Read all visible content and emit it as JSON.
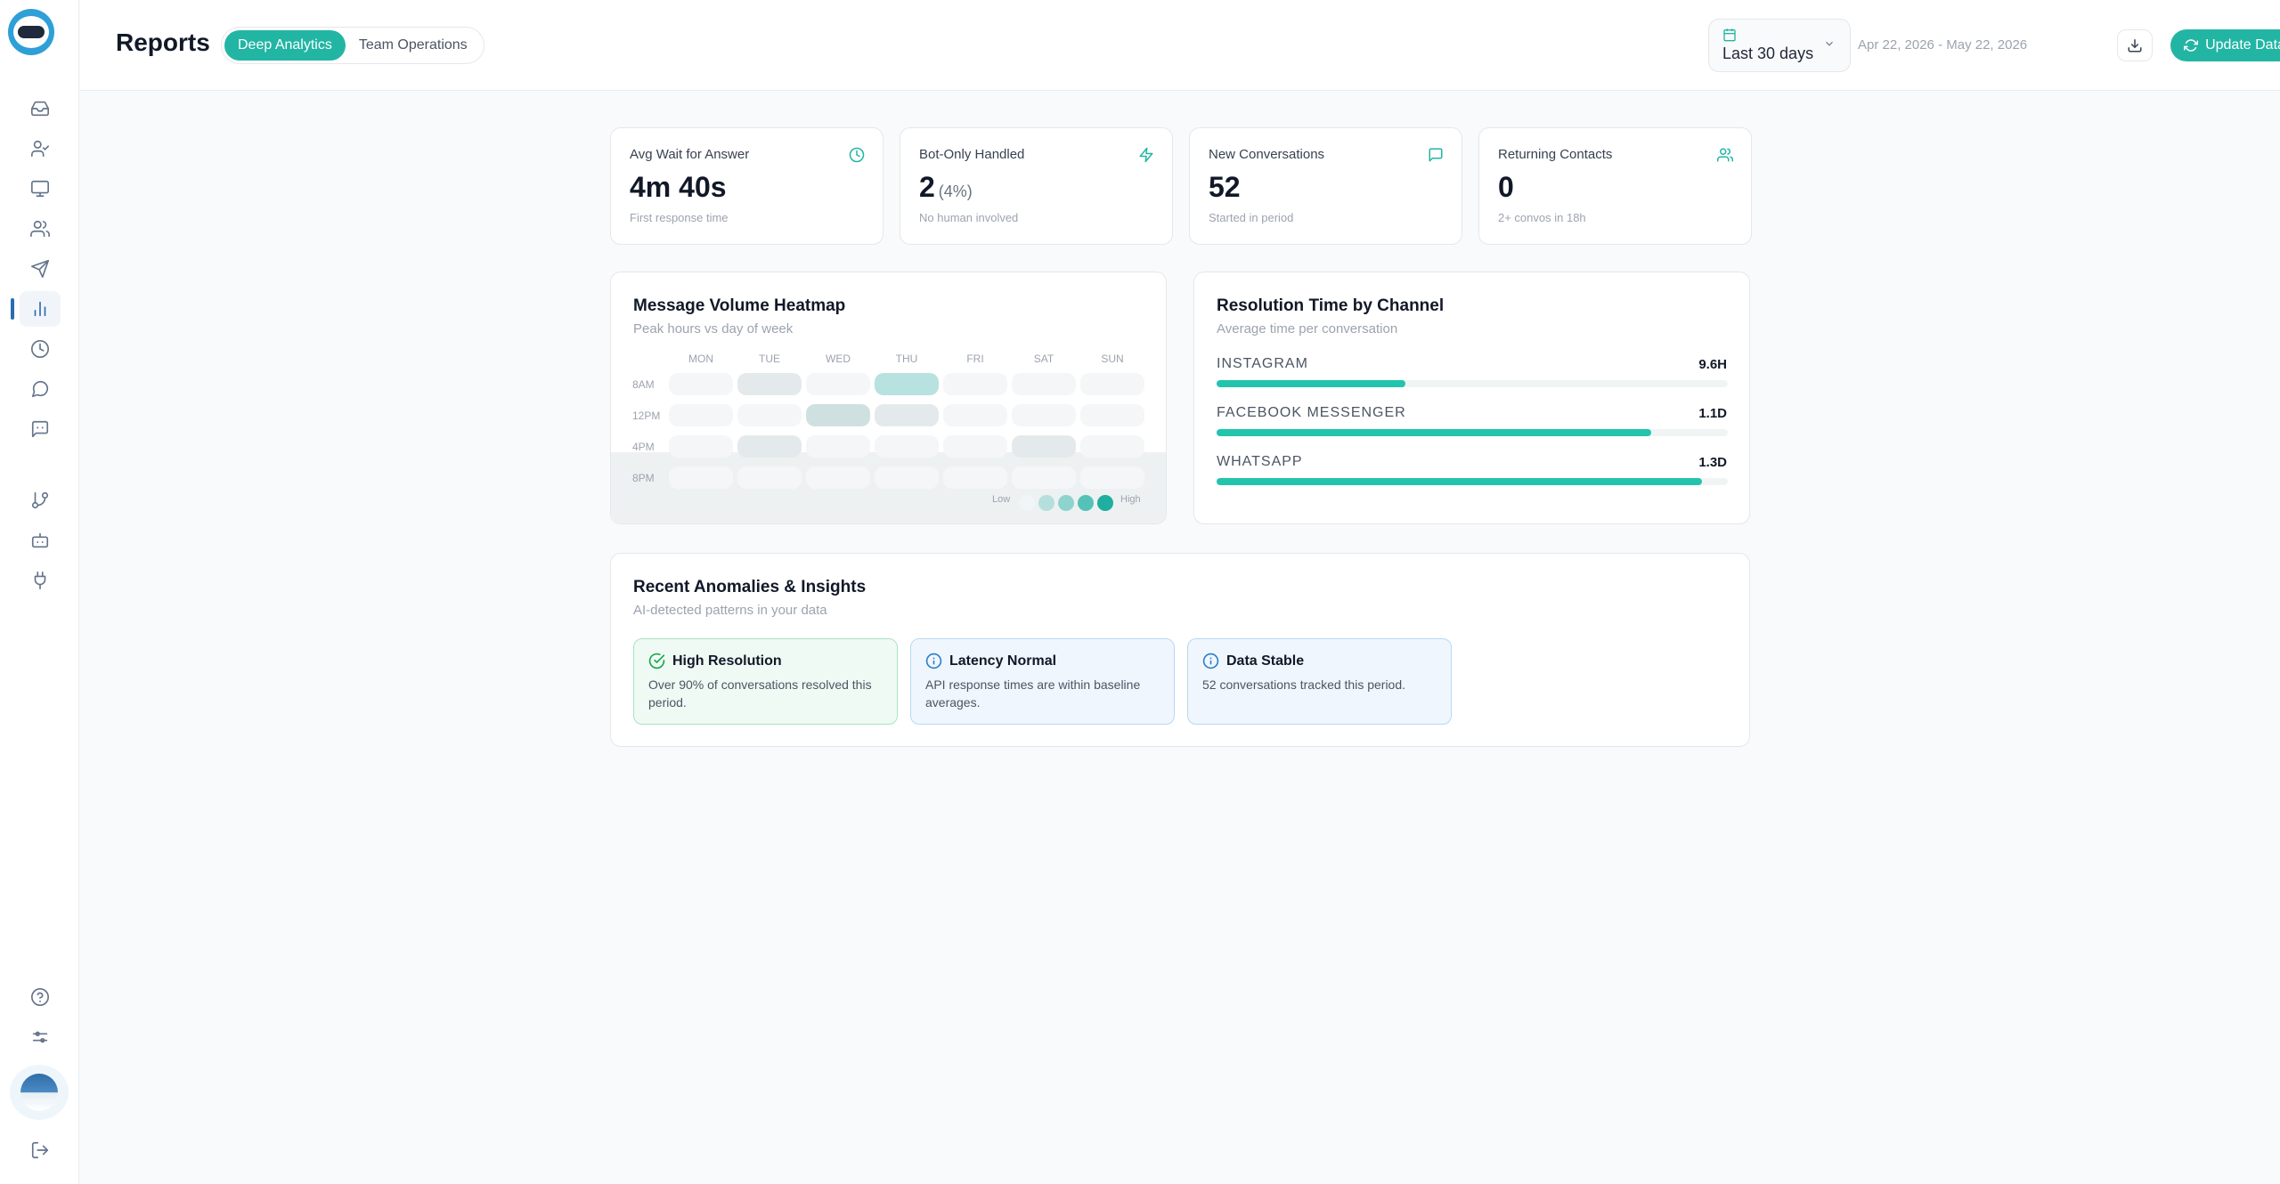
{
  "sidebar": {
    "nav": [
      {
        "name": "inbox",
        "icon": "inbox-icon"
      },
      {
        "name": "contacts",
        "icon": "user-check-icon"
      },
      {
        "name": "monitor",
        "icon": "monitor-icon"
      },
      {
        "name": "team",
        "icon": "users-icon"
      },
      {
        "name": "campaigns",
        "icon": "send-icon"
      },
      {
        "name": "reports",
        "icon": "bar-chart-icon",
        "active": true
      },
      {
        "name": "history",
        "icon": "clock-icon"
      },
      {
        "name": "conversations",
        "icon": "message-circle-icon"
      },
      {
        "name": "bot-chat",
        "icon": "bot-message-icon"
      },
      {
        "name": "flows",
        "icon": "git-branch-icon"
      },
      {
        "name": "bots",
        "icon": "robot-icon"
      },
      {
        "name": "integrations",
        "icon": "plug-icon"
      },
      {
        "name": "help",
        "icon": "help-circle-icon"
      },
      {
        "name": "settings",
        "icon": "sliders-icon"
      },
      {
        "name": "logout",
        "icon": "logout-icon"
      }
    ]
  },
  "header": {
    "title": "Reports",
    "tabs": [
      {
        "label": "Deep Analytics",
        "active": true
      },
      {
        "label": "Team Operations",
        "active": false
      }
    ],
    "date_picker_label": "Last 30 days",
    "date_range": "Apr 22, 2026 - May 22, 2026",
    "update_button": "Update Data"
  },
  "stats": [
    {
      "label": "Avg Wait for Answer",
      "value": "4m 40s",
      "suffix": "",
      "sub": "First response time",
      "icon": "clock-icon"
    },
    {
      "label": "Bot-Only Handled",
      "value": "2",
      "suffix": "(4%)",
      "sub": "No human involved",
      "icon": "zap-icon"
    },
    {
      "label": "New Conversations",
      "value": "52",
      "suffix": "",
      "sub": "Started in period",
      "icon": "message-square-icon"
    },
    {
      "label": "Returning Contacts",
      "value": "0",
      "suffix": "",
      "sub": "2+ convos in 18h",
      "icon": "users-icon"
    }
  ],
  "heatmap": {
    "title": "Message Volume Heatmap",
    "subtitle": "Peak hours vs day of week",
    "days": [
      "MON",
      "TUE",
      "WED",
      "THU",
      "FRI",
      "SAT",
      "SUN"
    ],
    "hours": [
      "8AM",
      "12PM",
      "4PM",
      "8PM"
    ],
    "levels": [
      [
        0,
        1,
        0,
        4,
        0,
        0,
        0
      ],
      [
        0,
        0,
        3,
        1,
        0,
        0,
        0
      ],
      [
        0,
        1,
        0,
        0,
        0,
        1,
        0
      ],
      [
        0,
        0,
        0,
        0,
        0,
        0,
        0
      ]
    ],
    "legend_low": "Low",
    "legend_high": "High",
    "legend_colors": [
      "#f1f5f5",
      "#b4dfdd",
      "#8fd3cf",
      "#55c2b8",
      "#1fae9f"
    ]
  },
  "resolution": {
    "title": "Resolution Time by Channel",
    "subtitle": "Average time per conversation",
    "channels": [
      {
        "name": "INSTAGRAM",
        "value": "9.6H",
        "fraction": 0.37
      },
      {
        "name": "FACEBOOK MESSENGER",
        "value": "1.1D",
        "fraction": 0.85
      },
      {
        "name": "WHATSAPP",
        "value": "1.3D",
        "fraction": 0.95
      }
    ]
  },
  "insights": {
    "title": "Recent Anomalies & Insights",
    "subtitle": "AI-detected patterns in your data",
    "items": [
      {
        "title": "High Resolution",
        "text": "Over 90% of conversations resolved this period.",
        "tone": "green",
        "icon": "check-circle-icon"
      },
      {
        "title": "Latency Normal",
        "text": "API response times are within baseline averages.",
        "tone": "blue",
        "icon": "info-icon"
      },
      {
        "title": "Data Stable",
        "text": "52 conversations tracked this period.",
        "tone": "blue",
        "icon": "info-icon"
      }
    ]
  },
  "colors": {
    "accent": "#22b5a4",
    "bar": "#22c4ac",
    "active_nav": "#2b6cb0"
  }
}
